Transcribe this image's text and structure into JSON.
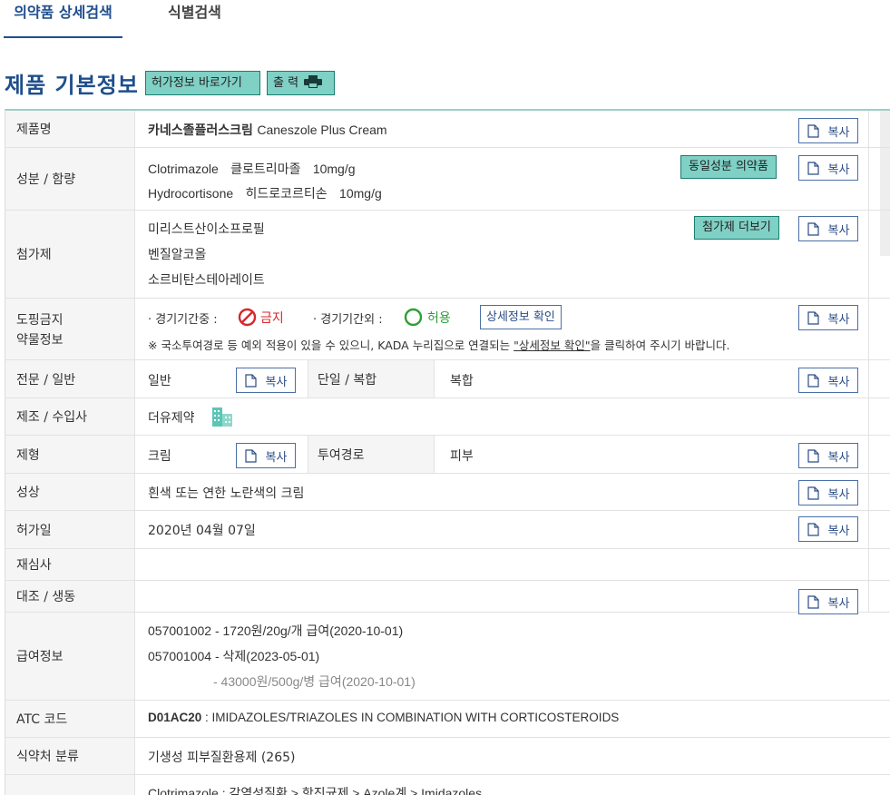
{
  "tabs": [
    {
      "label": "의약품 상세검색"
    },
    {
      "label": "식별검색"
    }
  ],
  "section": {
    "title": "제품 기본정보",
    "goto_label": "허가정보 바로가기",
    "print_label": "출 력"
  },
  "copy_label": "복사",
  "rows": {
    "product": {
      "label": "제품명",
      "name_ko": "카네스졸플러스크림",
      "name_en": "Caneszole Plus Cream"
    },
    "ingredient": {
      "label": "성분 / 함량",
      "items": [
        {
          "en": "Clotrimazole",
          "ko": "클로트리마졸",
          "amount": "10mg/g"
        },
        {
          "en": "Hydrocortisone",
          "ko": "히드로코르티손",
          "amount": "10mg/g"
        }
      ],
      "same_btn": "동일성분 의약품"
    },
    "additive": {
      "label": "첨가제",
      "items": [
        "미리스트산이소프로필",
        "벤질알코올",
        "소르비탄스테아레이트"
      ],
      "more_btn": "첨가제 더보기"
    },
    "doping": {
      "label_line1": "도핑금지",
      "label_line2": "약물정보",
      "in_comp": "· 경기기간중 :",
      "in_status": "금지",
      "out_comp": "· 경기기간외 :",
      "out_status": "허용",
      "detail_btn": "상세정보 확인",
      "note_prefix": "※ 국소투여경로 등 예외 적용이 있을 수 있으니, KADA 누리집으로 연결되는 ",
      "note_link": "\"상세정보 확인\"",
      "note_suffix": "을 클릭하여 주시기 바랍니다."
    },
    "type": {
      "label": "전문 / 일반",
      "value": "일반",
      "sub_label": "단일 / 복합",
      "sub_value": "복합"
    },
    "maker": {
      "label": "제조 / 수입사",
      "value": "더유제약"
    },
    "form": {
      "label": "제형",
      "value": "크림",
      "sub_label": "투여경로",
      "sub_value": "피부"
    },
    "appearance": {
      "label": "성상",
      "value": "흰색 또는 연한 노란색의 크림"
    },
    "approval": {
      "label": "허가일",
      "value": "2020년 04월 07일"
    },
    "reexam": {
      "label": "재심사",
      "value": ""
    },
    "compare": {
      "label": "대조 / 생동",
      "value": ""
    },
    "insurance": {
      "label": "급여정보",
      "line1": "057001002 - 1720원/20g/개 급여(2020-10-01)",
      "line2": "057001004 - 삭제(2023-05-01)",
      "line3": "- 43000원/500g/병 급여(2020-10-01)"
    },
    "atc": {
      "label": "ATC 코드",
      "code": "D01AC20",
      "desc": " : IMIDAZOLES/TRIAZOLES IN COMBINATION WITH CORTICOSTEROIDS"
    },
    "mfds": {
      "label": "식약처 분류",
      "value": "기생성 피부질환용제 (265)"
    },
    "classification": {
      "label": "",
      "value": "Clotrimazole : 감염성질환 > 항진균제 > Azole계 > Imidazoles"
    }
  },
  "colors": {
    "brand_blue": "#1f4e8c",
    "teal": "#7fd0c5",
    "red": "#d8262c",
    "green": "#2e9f35"
  }
}
